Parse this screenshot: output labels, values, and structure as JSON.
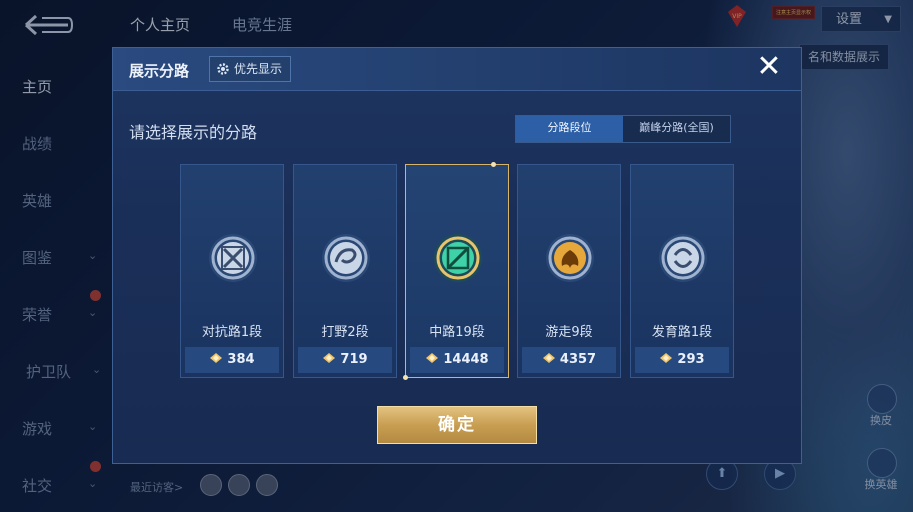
{
  "topbar": {
    "tabs": [
      {
        "label": "个人主页",
        "active": true
      },
      {
        "label": "电竞生涯",
        "active": false
      }
    ],
    "settings_label": "设置",
    "vip_label": "VIP",
    "vip_text": "注意主页显示权",
    "data_display_label": "名和数据展示"
  },
  "sidebar": {
    "items": [
      {
        "label": "主页",
        "active": true,
        "chevron": false
      },
      {
        "label": "战绩",
        "active": false,
        "chevron": false
      },
      {
        "label": "英雄",
        "active": false,
        "chevron": false
      },
      {
        "label": "图鉴",
        "active": false,
        "chevron": true
      },
      {
        "label": "荣誉",
        "active": false,
        "chevron": true
      },
      {
        "label": "护卫队",
        "active": false,
        "chevron": true
      },
      {
        "label": "游戏",
        "active": false,
        "chevron": true
      },
      {
        "label": "社交",
        "active": false,
        "chevron": true
      }
    ]
  },
  "footer": {
    "recent_visitors_label": "最近访客>"
  },
  "right_panel": {
    "skin_label": "换皮",
    "hero_label": "换英雄"
  },
  "modal": {
    "title": "展示分路",
    "priority_label": "优先显示",
    "close_label": "✕",
    "subtitle": "请选择展示的分路",
    "segments": [
      {
        "label": "分路段位",
        "active": true
      },
      {
        "label": "巅峰分路(全国)",
        "active": false
      }
    ],
    "lanes": [
      {
        "name": "对抗路1段",
        "points": "384",
        "selected": false,
        "icon": "clash-lane-icon",
        "color": "#c9d6e8"
      },
      {
        "name": "打野2段",
        "points": "719",
        "selected": false,
        "icon": "jungle-icon",
        "color": "#c9d6e8"
      },
      {
        "name": "中路19段",
        "points": "14448",
        "selected": true,
        "icon": "mid-lane-icon",
        "color": "#3fd1a8"
      },
      {
        "name": "游走9段",
        "points": "4357",
        "selected": false,
        "icon": "roam-icon",
        "color": "#e6a83a"
      },
      {
        "name": "发育路1段",
        "points": "293",
        "selected": false,
        "icon": "farm-lane-icon",
        "color": "#c9d6e8"
      }
    ],
    "confirm_label": "确定"
  }
}
